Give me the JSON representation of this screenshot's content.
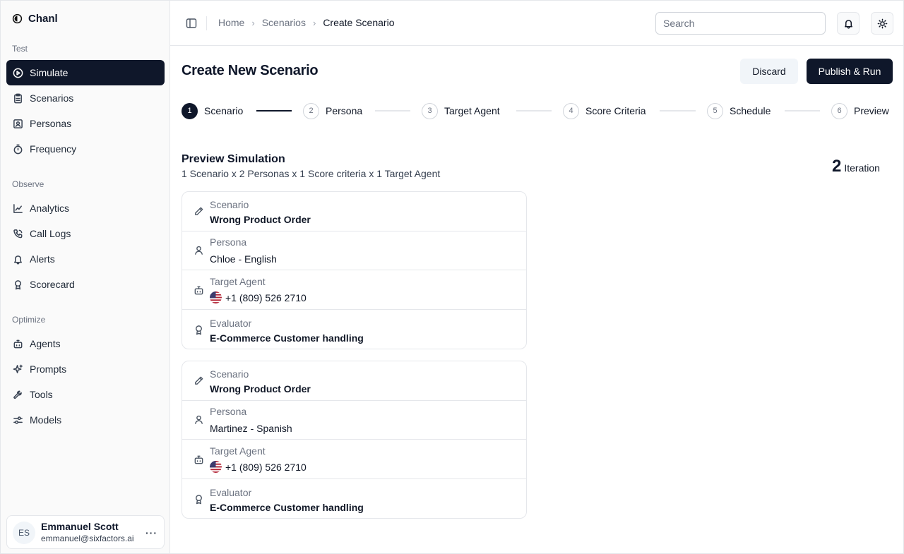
{
  "brand": {
    "name": "Chanl"
  },
  "sidebar": {
    "sections": [
      {
        "label": "Test",
        "items": [
          "Simulate",
          "Scenarios",
          "Personas",
          "Frequency"
        ]
      },
      {
        "label": "Observe",
        "items": [
          "Analytics",
          "Call Logs",
          "Alerts",
          "Scorecard"
        ]
      },
      {
        "label": "Optimize",
        "items": [
          "Agents",
          "Prompts",
          "Tools",
          "Models"
        ]
      }
    ],
    "active_item": "Simulate"
  },
  "user": {
    "initials": "ES",
    "name": "Emmanuel Scott",
    "email": "emmanuel@sixfactors.ai",
    "more": "···"
  },
  "breadcrumb": {
    "home": "Home",
    "scenarios": "Scenarios",
    "current": "Create Scenario",
    "separator": "›"
  },
  "search": {
    "placeholder": "Search"
  },
  "page": {
    "title": "Create New Scenario",
    "discard_label": "Discard",
    "publish_label": "Publish & Run"
  },
  "stepper": {
    "current": 1,
    "steps": [
      {
        "num": "1",
        "label": "Scenario"
      },
      {
        "num": "2",
        "label": "Persona"
      },
      {
        "num": "3",
        "label": "Target Agent"
      },
      {
        "num": "4",
        "label": "Score Criteria"
      },
      {
        "num": "5",
        "label": "Schedule"
      },
      {
        "num": "6",
        "label": "Preview"
      }
    ]
  },
  "preview": {
    "title": "Preview Simulation",
    "subtitle": "1 Scenario x 2 Personas x 1 Score criteria x 1 Target Agent",
    "iteration_count": "2",
    "iteration_label": "Iteration",
    "labels": {
      "scenario": "Scenario",
      "persona": "Persona",
      "target_agent": "Target Agent",
      "evaluator": "Evaluator"
    },
    "cards": [
      {
        "scenario": "Wrong Product Order",
        "persona": "Chloe - English",
        "target_agent": "+1 (809) 526 2710",
        "evaluator": "E-Commerce Customer handling"
      },
      {
        "scenario": "Wrong Product Order",
        "persona": "Martinez - Spanish",
        "target_agent": "+1 (809) 526 2710",
        "evaluator": "E-Commerce Customer handling"
      }
    ]
  },
  "icons": {
    "nav": [
      "play-circle-icon",
      "clipboard-icon",
      "contact-icon",
      "timer-icon",
      "line-chart-icon",
      "phone-icon",
      "bell-icon",
      "award-icon",
      "bot-icon",
      "sparkles-icon",
      "wrench-icon",
      "sliders-icon"
    ],
    "topbar": [
      "sidebar-toggle-icon",
      "bell-icon",
      "sun-icon"
    ],
    "rows": [
      "pencil-icon",
      "user-icon",
      "bot-icon",
      "award-icon"
    ],
    "flag": "us-flag-icon"
  },
  "colors": {
    "primary": "#0f172a",
    "muted_text": "#6b7280",
    "border": "#e5e7eb",
    "sidebar_bg": "#fafafa"
  }
}
